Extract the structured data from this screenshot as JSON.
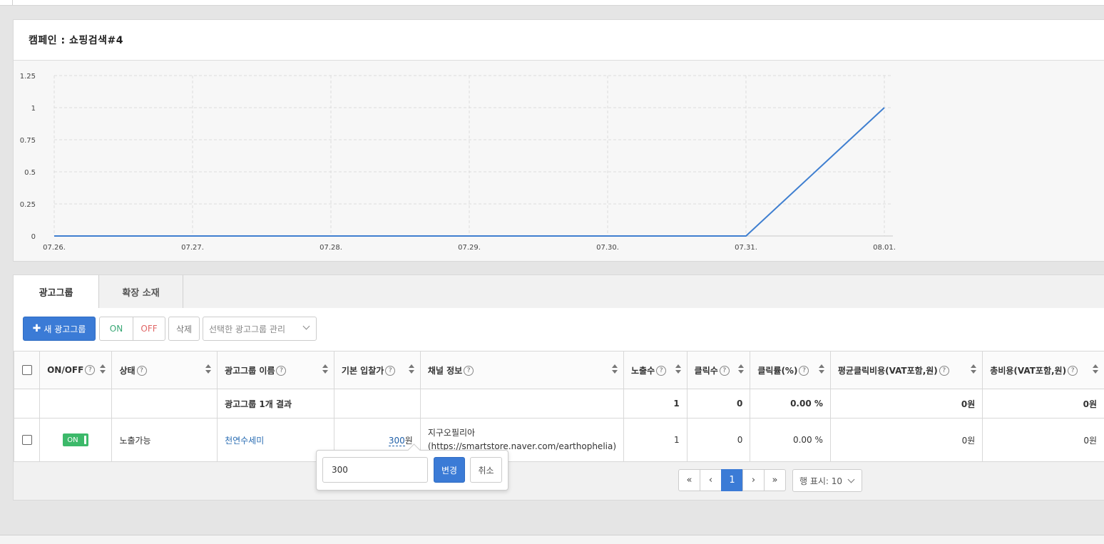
{
  "campaign": {
    "title": "캠페인 : 쇼핑검색#4"
  },
  "chart_data": {
    "type": "line",
    "x": [
      "07.26.",
      "07.27.",
      "07.28.",
      "07.29.",
      "07.30.",
      "07.31.",
      "08.01."
    ],
    "series": [
      {
        "values": [
          0,
          0,
          0,
          0,
          0,
          0,
          1
        ]
      }
    ],
    "yticks": [
      "1.25",
      "1",
      "0.75",
      "0.5",
      "0.25",
      "0"
    ],
    "ylim": [
      0,
      1.25
    ],
    "grid": true,
    "line_color": "#3f7fd0"
  },
  "tabs": [
    {
      "label": "광고그룹"
    },
    {
      "label": "확장 소재"
    }
  ],
  "toolbar": {
    "new_label": "새 광고그룹",
    "on_label": "ON",
    "off_label": "OFF",
    "delete_label": "삭제",
    "manage_label": "선택한 광고그룹 관리"
  },
  "table": {
    "headers": [
      "ON/OFF",
      "상태",
      "광고그룹 이름",
      "기본 입찰가",
      "채널 정보",
      "노출수",
      "클릭수",
      "클릭률(%)",
      "평균클릭비용(VAT포함,원)",
      "총비용(VAT포함,원)"
    ],
    "summary": {
      "label": "광고그룹 1개 결과",
      "impressions": "1",
      "clicks": "0",
      "ctr": "0.00 %",
      "avg_cpc": "0원",
      "total_cost": "0원"
    },
    "row": {
      "toggle": "ON",
      "status": "노출가능",
      "name": "천연수세미",
      "bid_value": "300",
      "bid_unit": "원",
      "channel": "지구오필리아 (https://smartstore.naver.com/earthophelia)",
      "impressions": "1",
      "clicks": "0",
      "ctr": "0.00 %",
      "avg_cpc": "0원",
      "total_cost": "0원"
    }
  },
  "bid_popover": {
    "input_value": "300",
    "change_label": "변경",
    "cancel_label": "취소"
  },
  "pagination": {
    "first": "«",
    "prev": "‹",
    "current": "1",
    "next": "›",
    "last": "»",
    "rows_label": "행 표시: 10"
  },
  "colors": {
    "accent": "#3b7bd6",
    "toggle_on": "#3cb96a",
    "link": "#2a6db3"
  }
}
